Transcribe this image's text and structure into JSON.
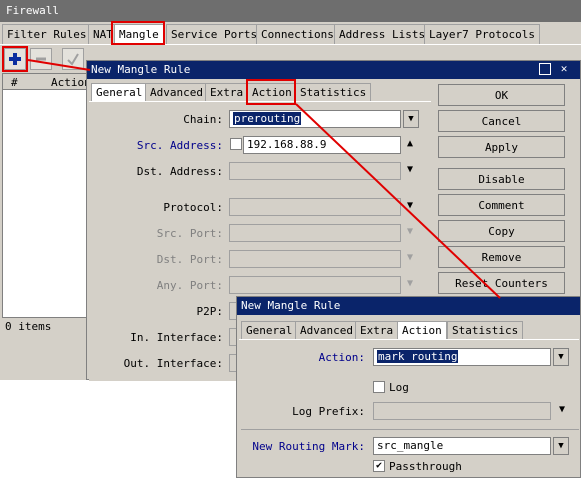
{
  "firewall": {
    "title": "Firewall",
    "tabs": [
      "Filter Rules",
      "NAT",
      "Mangle",
      "Service Ports",
      "Connections",
      "Address Lists",
      "Layer7 Protocols"
    ],
    "active_tab": "Mangle",
    "table_headers": [
      "#",
      "Action"
    ],
    "status": "0 items"
  },
  "dialog1": {
    "title": "New Mangle Rule",
    "tabs": [
      "General",
      "Advanced",
      "Extra",
      "Action",
      "Statistics"
    ],
    "active_tab": "General",
    "fields": {
      "chain_label": "Chain:",
      "chain_value": "prerouting",
      "src_address_label": "Src. Address:",
      "src_address_value": "192.168.88.9",
      "dst_address_label": "Dst. Address:",
      "protocol_label": "Protocol:",
      "src_port_label": "Src. Port:",
      "dst_port_label": "Dst. Port:",
      "any_port_label": "Any. Port:",
      "p2p_label": "P2P:",
      "in_interface_label": "In. Interface:",
      "out_interface_label": "Out. Interface:"
    },
    "buttons": [
      "OK",
      "Cancel",
      "Apply",
      "Disable",
      "Comment",
      "Copy",
      "Remove",
      "Reset Counters"
    ]
  },
  "dialog2": {
    "title": "New Mangle Rule",
    "tabs": [
      "General",
      "Advanced",
      "Extra",
      "Action",
      "Statistics"
    ],
    "active_tab": "Action",
    "fields": {
      "action_label": "Action:",
      "action_value": "mark routing",
      "log_label": "Log",
      "log_prefix_label": "Log Prefix:",
      "routing_mark_label": "New Routing Mark:",
      "routing_mark_value": "src_mangle",
      "passthrough_label": "Passthrough"
    }
  },
  "colors": {
    "window_bg": "#d4d0c8",
    "title_active": "#0a246a",
    "annotation_red": "#e00000",
    "label_blue": "#00008b"
  }
}
